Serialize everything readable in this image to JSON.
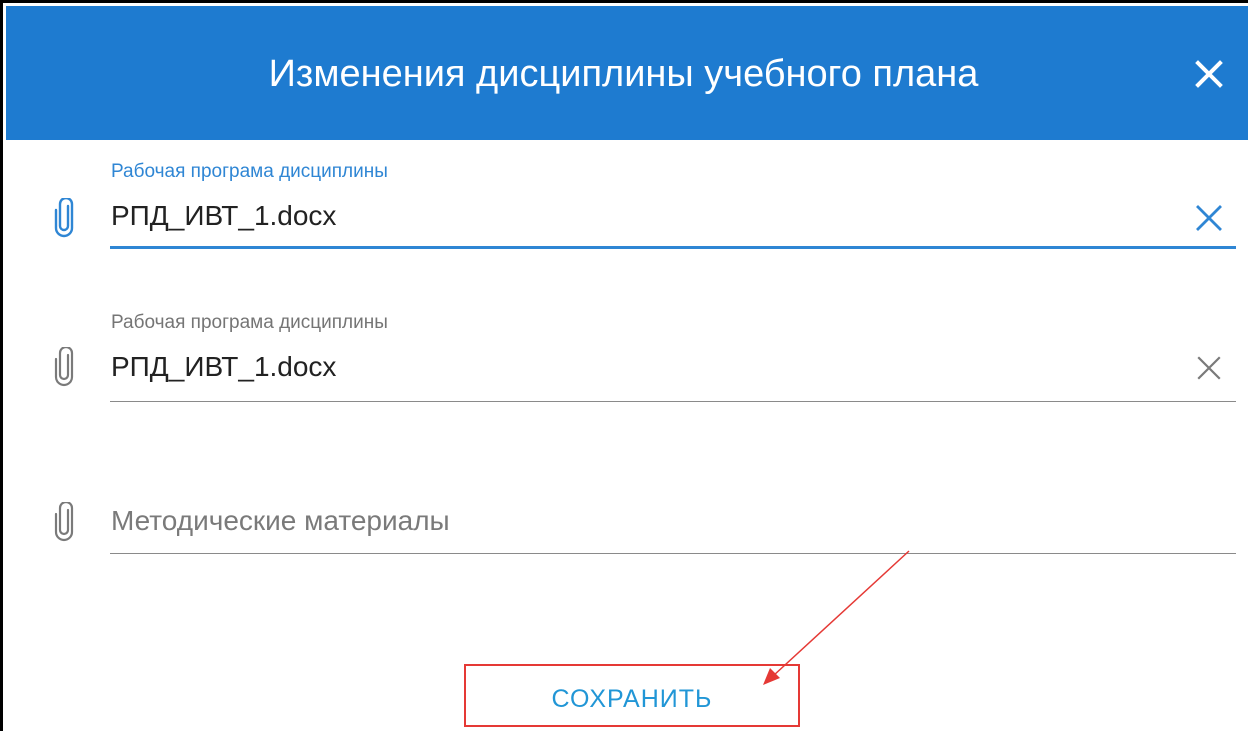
{
  "dialog": {
    "title": "Изменения дисциплины учебного плана",
    "close_icon": "close-icon",
    "header_color": "#1e7bd0"
  },
  "fields": [
    {
      "label": "Рабочая програма дисциплины",
      "value": "РПД_ИВТ_1.docx",
      "state": "focused",
      "icon": "paperclip-icon",
      "clear_icon": "clear-icon"
    },
    {
      "label": "Рабочая програма дисциплины",
      "value": "РПД_ИВТ_1.docx",
      "state": "filled",
      "icon": "paperclip-icon",
      "clear_icon": "clear-icon"
    },
    {
      "placeholder": "Методические материалы",
      "state": "empty",
      "icon": "paperclip-icon"
    }
  ],
  "actions": {
    "save_label": "СОХРАНИТЬ"
  },
  "colors": {
    "accent": "#1e7bd0",
    "focus": "#2f86d4",
    "annotation": "#e53935",
    "button_text": "#2196d6"
  }
}
